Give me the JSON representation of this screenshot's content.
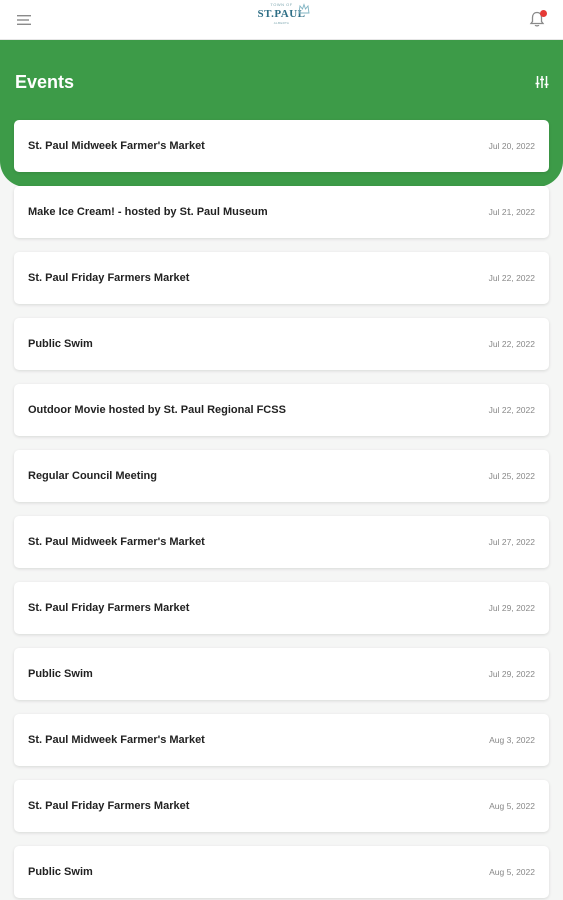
{
  "app": {
    "logo": {
      "top_text": "TOWN OF",
      "name": "ST.PAUL",
      "bottom_text": "ALBERTA"
    },
    "icons": {
      "menu": "hamburger-menu-icon",
      "notifications": "bell-icon",
      "filter": "sliders-icon",
      "logo_mark": "crown-icon"
    },
    "colors": {
      "primary": "#3d9b48",
      "badge": "#e53935"
    }
  },
  "header": {
    "title": "Events"
  },
  "events": [
    {
      "title": "St. Paul Midweek Farmer's Market",
      "date": "Jul 20, 2022"
    },
    {
      "title": "Make Ice Cream! - hosted by St. Paul Museum",
      "date": "Jul 21, 2022"
    },
    {
      "title": "St. Paul Friday Farmers Market",
      "date": "Jul 22, 2022"
    },
    {
      "title": "Public Swim",
      "date": "Jul 22, 2022"
    },
    {
      "title": "Outdoor Movie hosted by St. Paul Regional FCSS",
      "date": "Jul 22, 2022"
    },
    {
      "title": "Regular Council Meeting",
      "date": "Jul 25, 2022"
    },
    {
      "title": "St. Paul Midweek Farmer's Market",
      "date": "Jul 27, 2022"
    },
    {
      "title": "St. Paul Friday Farmers Market",
      "date": "Jul 29, 2022"
    },
    {
      "title": "Public Swim",
      "date": "Jul 29, 2022"
    },
    {
      "title": "St. Paul Midweek Farmer's Market",
      "date": "Aug 3, 2022"
    },
    {
      "title": "St. Paul Friday Farmers Market",
      "date": "Aug 5, 2022"
    },
    {
      "title": "Public Swim",
      "date": "Aug 5, 2022"
    }
  ]
}
